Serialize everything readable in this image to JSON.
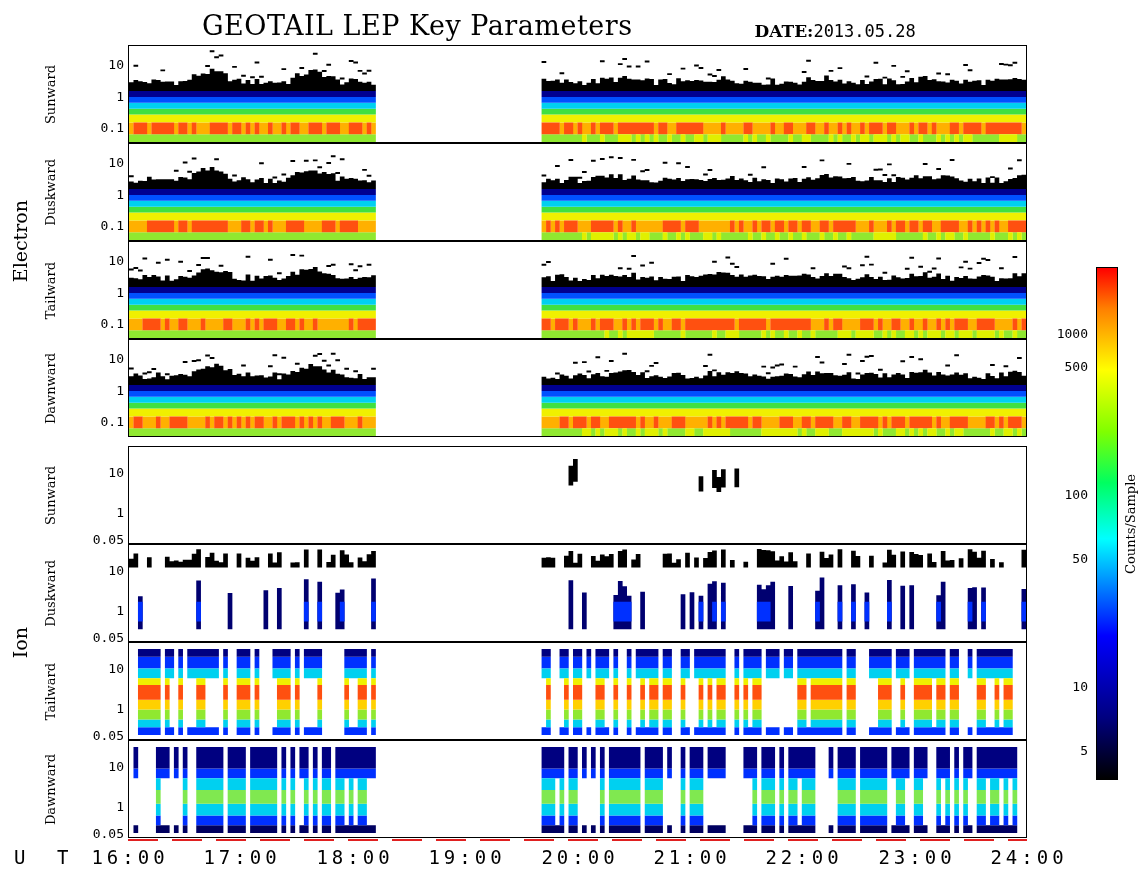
{
  "title": "GEOTAIL LEP Key Parameters",
  "date": "**DATE:**2013.05.28",
  "groups": [
    {
      "label": "Electron",
      "panels": [
        {
          "label": "Sunward",
          "kind": "electron",
          "y_ticks": [
            "10",
            "1",
            "0.1"
          ]
        },
        {
          "label": "Duskward",
          "kind": "electron",
          "y_ticks": [
            "10",
            "1",
            "0.1"
          ]
        },
        {
          "label": "Tailward",
          "kind": "electron",
          "y_ticks": [
            "10",
            "1",
            "0.1"
          ]
        },
        {
          "label": "Dawnward",
          "kind": "electron",
          "y_ticks": [
            "10",
            "1",
            "0.1"
          ]
        }
      ]
    },
    {
      "label": "Ion",
      "panels": [
        {
          "label": "Sunward",
          "kind": "sparse",
          "y_ticks": [
            "10",
            "1",
            "0.05"
          ]
        },
        {
          "label": "Duskward",
          "kind": "dusk",
          "y_ticks": [
            "10",
            "1",
            "0.05"
          ]
        },
        {
          "label": "Tailward",
          "kind": "tail",
          "y_ticks": [
            "10",
            "1",
            "0.05"
          ]
        },
        {
          "label": "Dawnward",
          "kind": "dawn",
          "y_ticks": [
            "10",
            "1",
            "0.05"
          ]
        }
      ]
    }
  ],
  "x_axis": {
    "label": "U T",
    "ticks": [
      "16:00",
      "17:00",
      "18:00",
      "19:00",
      "20:00",
      "21:00",
      "22:00",
      "23:00",
      "24:00"
    ]
  },
  "colorbar": {
    "label": "Counts/Sample",
    "ticks": [
      "1000",
      "500",
      "100",
      "50",
      "10",
      "5"
    ]
  }
}
